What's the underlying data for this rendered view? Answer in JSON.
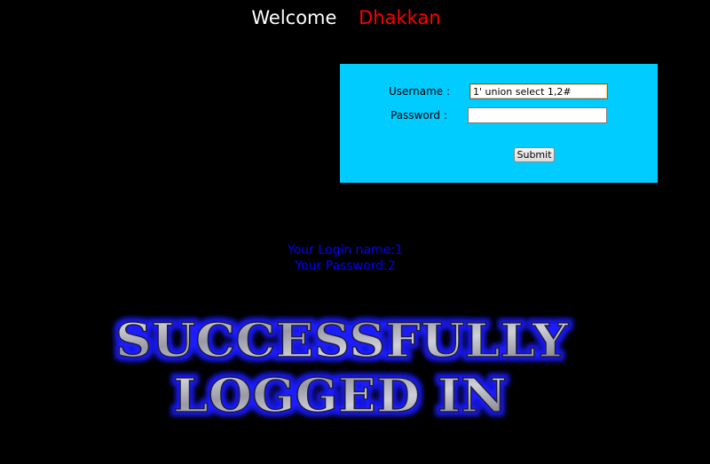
{
  "header": {
    "welcome_label": "Welcome",
    "user_name": "Dhakkan"
  },
  "login_form": {
    "username_label": "Username :",
    "username_value": "1' union select 1,2#",
    "password_label": "Password :",
    "password_value": "",
    "submit_label": "Submit"
  },
  "result": {
    "login_name_line": "Your Login name:1",
    "password_line": "Your Password:2"
  },
  "banner": {
    "line1": "SUCCESSFULLY",
    "line2": "LOGGED IN"
  },
  "colors": {
    "background": "#000000",
    "form_background": "#00ccff",
    "welcome_name": "#ff0000",
    "result_text": "#0000ff",
    "banner_glow": "#2222ff"
  }
}
